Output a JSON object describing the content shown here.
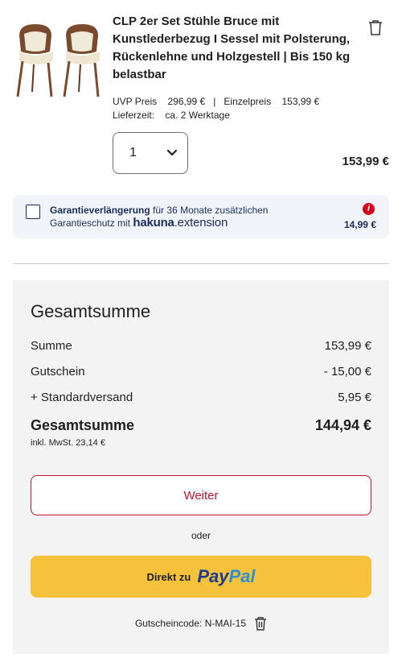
{
  "product": {
    "title": "CLP 2er Set Stühle Bruce mit Kunstlederbezug I Sessel mit Polsterung, Rückenlehne und Holzgestell | Bis 150 kg belastbar",
    "uvp_label": "UVP Preis",
    "uvp_value": "296,99 €",
    "separator": "|",
    "single_label": "Einzelpreis",
    "single_value": "153,99 €",
    "delivery_label": "Lieferzeit:",
    "delivery_value": "ca. 2 Werktage",
    "quantity": "1",
    "price": "153,99 €"
  },
  "warranty": {
    "bold": "Garantieverlängerung",
    "text_1": " für 36 Monate zusätzlichen",
    "text_2": "Garantieschutz mit ",
    "brand_a": "hakuna",
    "brand_b": ".extension",
    "info": "i",
    "price": "14,99 €"
  },
  "summary": {
    "title": "Gesamtsumme",
    "rows": [
      {
        "label": "Summe",
        "value": "153,99 €"
      },
      {
        "label": "Gutschein",
        "value": "- 15,00 €"
      },
      {
        "label": "+ Standardversand",
        "value": "5,95 €"
      }
    ],
    "total_label": "Gesamtsumme",
    "total_value": "144,94 €",
    "vat": "inkl. MwSt. 23,14 €",
    "continue_label": "Weiter",
    "or": "oder",
    "paypal_label": "Direkt zu",
    "paypal_a": "Pay",
    "paypal_b": "Pal",
    "coupon": "Gutscheincode: N-MAI-15"
  },
  "colors": {
    "accent_red": "#c8102e",
    "paypal_yellow": "#f7c23b",
    "navy": "#1c2c5a"
  }
}
